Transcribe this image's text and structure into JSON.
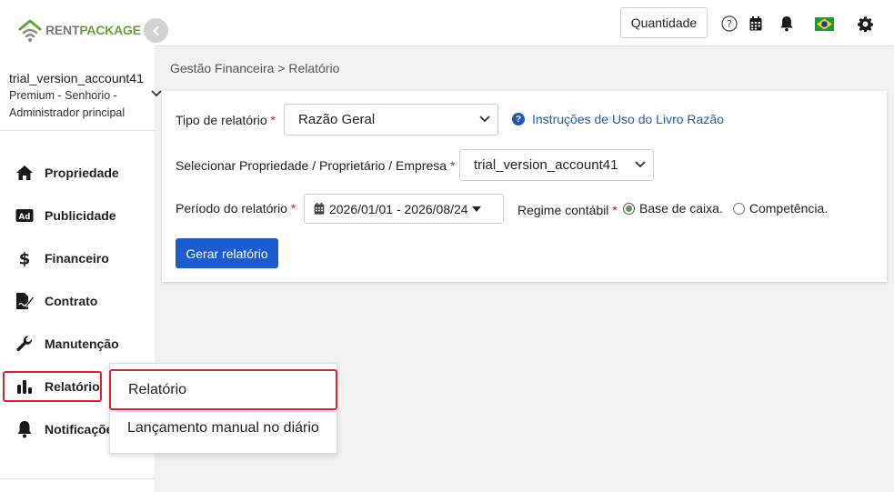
{
  "brand": {
    "logo_rent": "RENT",
    "logo_package": "PACKAGE",
    "accent_green": "#5fa832",
    "accent_blue": "#1c5cd0",
    "highlight_red": "#d9252f"
  },
  "account": {
    "name": "trial_version_account41",
    "role_line1": "Premium - Senhorio -",
    "role_line2": "Administrador principal"
  },
  "sidebar": {
    "items": [
      {
        "label": "Propriedade",
        "icon": "home-icon"
      },
      {
        "label": "Publicidade",
        "icon": "ad-icon"
      },
      {
        "label": "Financeiro",
        "icon": "dollar-icon"
      },
      {
        "label": "Contrato",
        "icon": "contract-icon"
      },
      {
        "label": "Manutenção",
        "icon": "wrench-icon"
      },
      {
        "label": "Relatório",
        "icon": "bar-chart-icon",
        "active": true
      },
      {
        "label": "Notificações",
        "icon": "bell-icon"
      }
    ]
  },
  "topbar": {
    "quantity_label": "Quantidade",
    "icons": [
      "help-icon",
      "calendar-icon",
      "bell-icon",
      "brazil-flag-icon",
      "gear-icon"
    ]
  },
  "breadcrumb": "Gestão Financeira > Relatório",
  "form": {
    "report_type_label": "Tipo de relatório",
    "report_type_value": "Razão Geral",
    "help_link": "Instruções de Uso do Livro Razão",
    "entity_label": "Selecionar Propriedade / Proprietário / Empresa",
    "entity_value": "trial_version_account41",
    "period_label": "Período do relatório",
    "period_value": "2026/01/01 - 2026/08/24",
    "regime_label": "Regime contábil",
    "regime_options": [
      {
        "label": "Base de caixa.",
        "checked": true
      },
      {
        "label": "Competência.",
        "checked": false
      }
    ],
    "required_mark": "*",
    "generate_button": "Gerar relatório"
  },
  "popup": {
    "items": [
      {
        "label": "Relatório",
        "selected": true
      },
      {
        "label": "Lançamento manual no diário",
        "selected": false
      }
    ]
  }
}
